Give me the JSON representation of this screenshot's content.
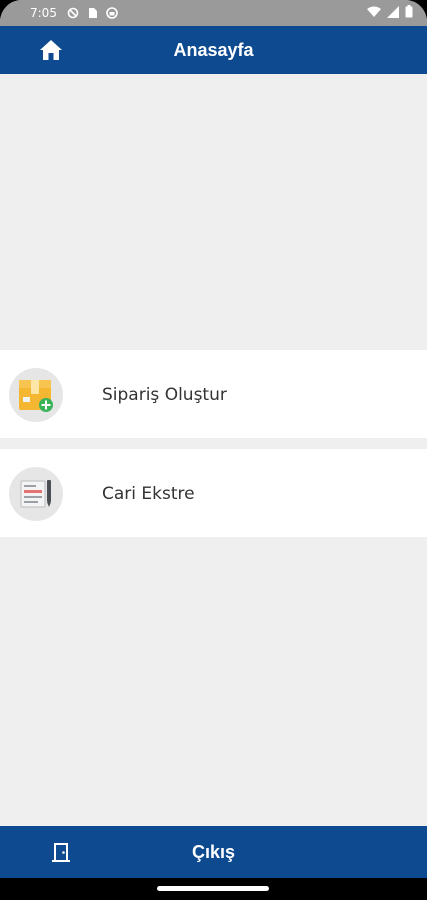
{
  "status_bar": {
    "time": "7:05",
    "icons": [
      "do-not-disturb-icon",
      "sim-card-icon",
      "vpn-icon",
      "wifi-icon",
      "signal-icon",
      "battery-icon"
    ]
  },
  "header": {
    "title": "Anasayfa",
    "home_icon": "home-icon",
    "color": "#0e4a8f"
  },
  "menu": {
    "items": [
      {
        "label": "Sipariş Oluştur",
        "icon": "package-add-icon"
      },
      {
        "label": "Cari Ekstre",
        "icon": "statement-document-icon"
      }
    ]
  },
  "footer": {
    "label": "Çıkış",
    "icon": "door-exit-icon"
  },
  "colors": {
    "primary": "#0e4a8f",
    "background": "#efefef",
    "card": "#ffffff"
  }
}
